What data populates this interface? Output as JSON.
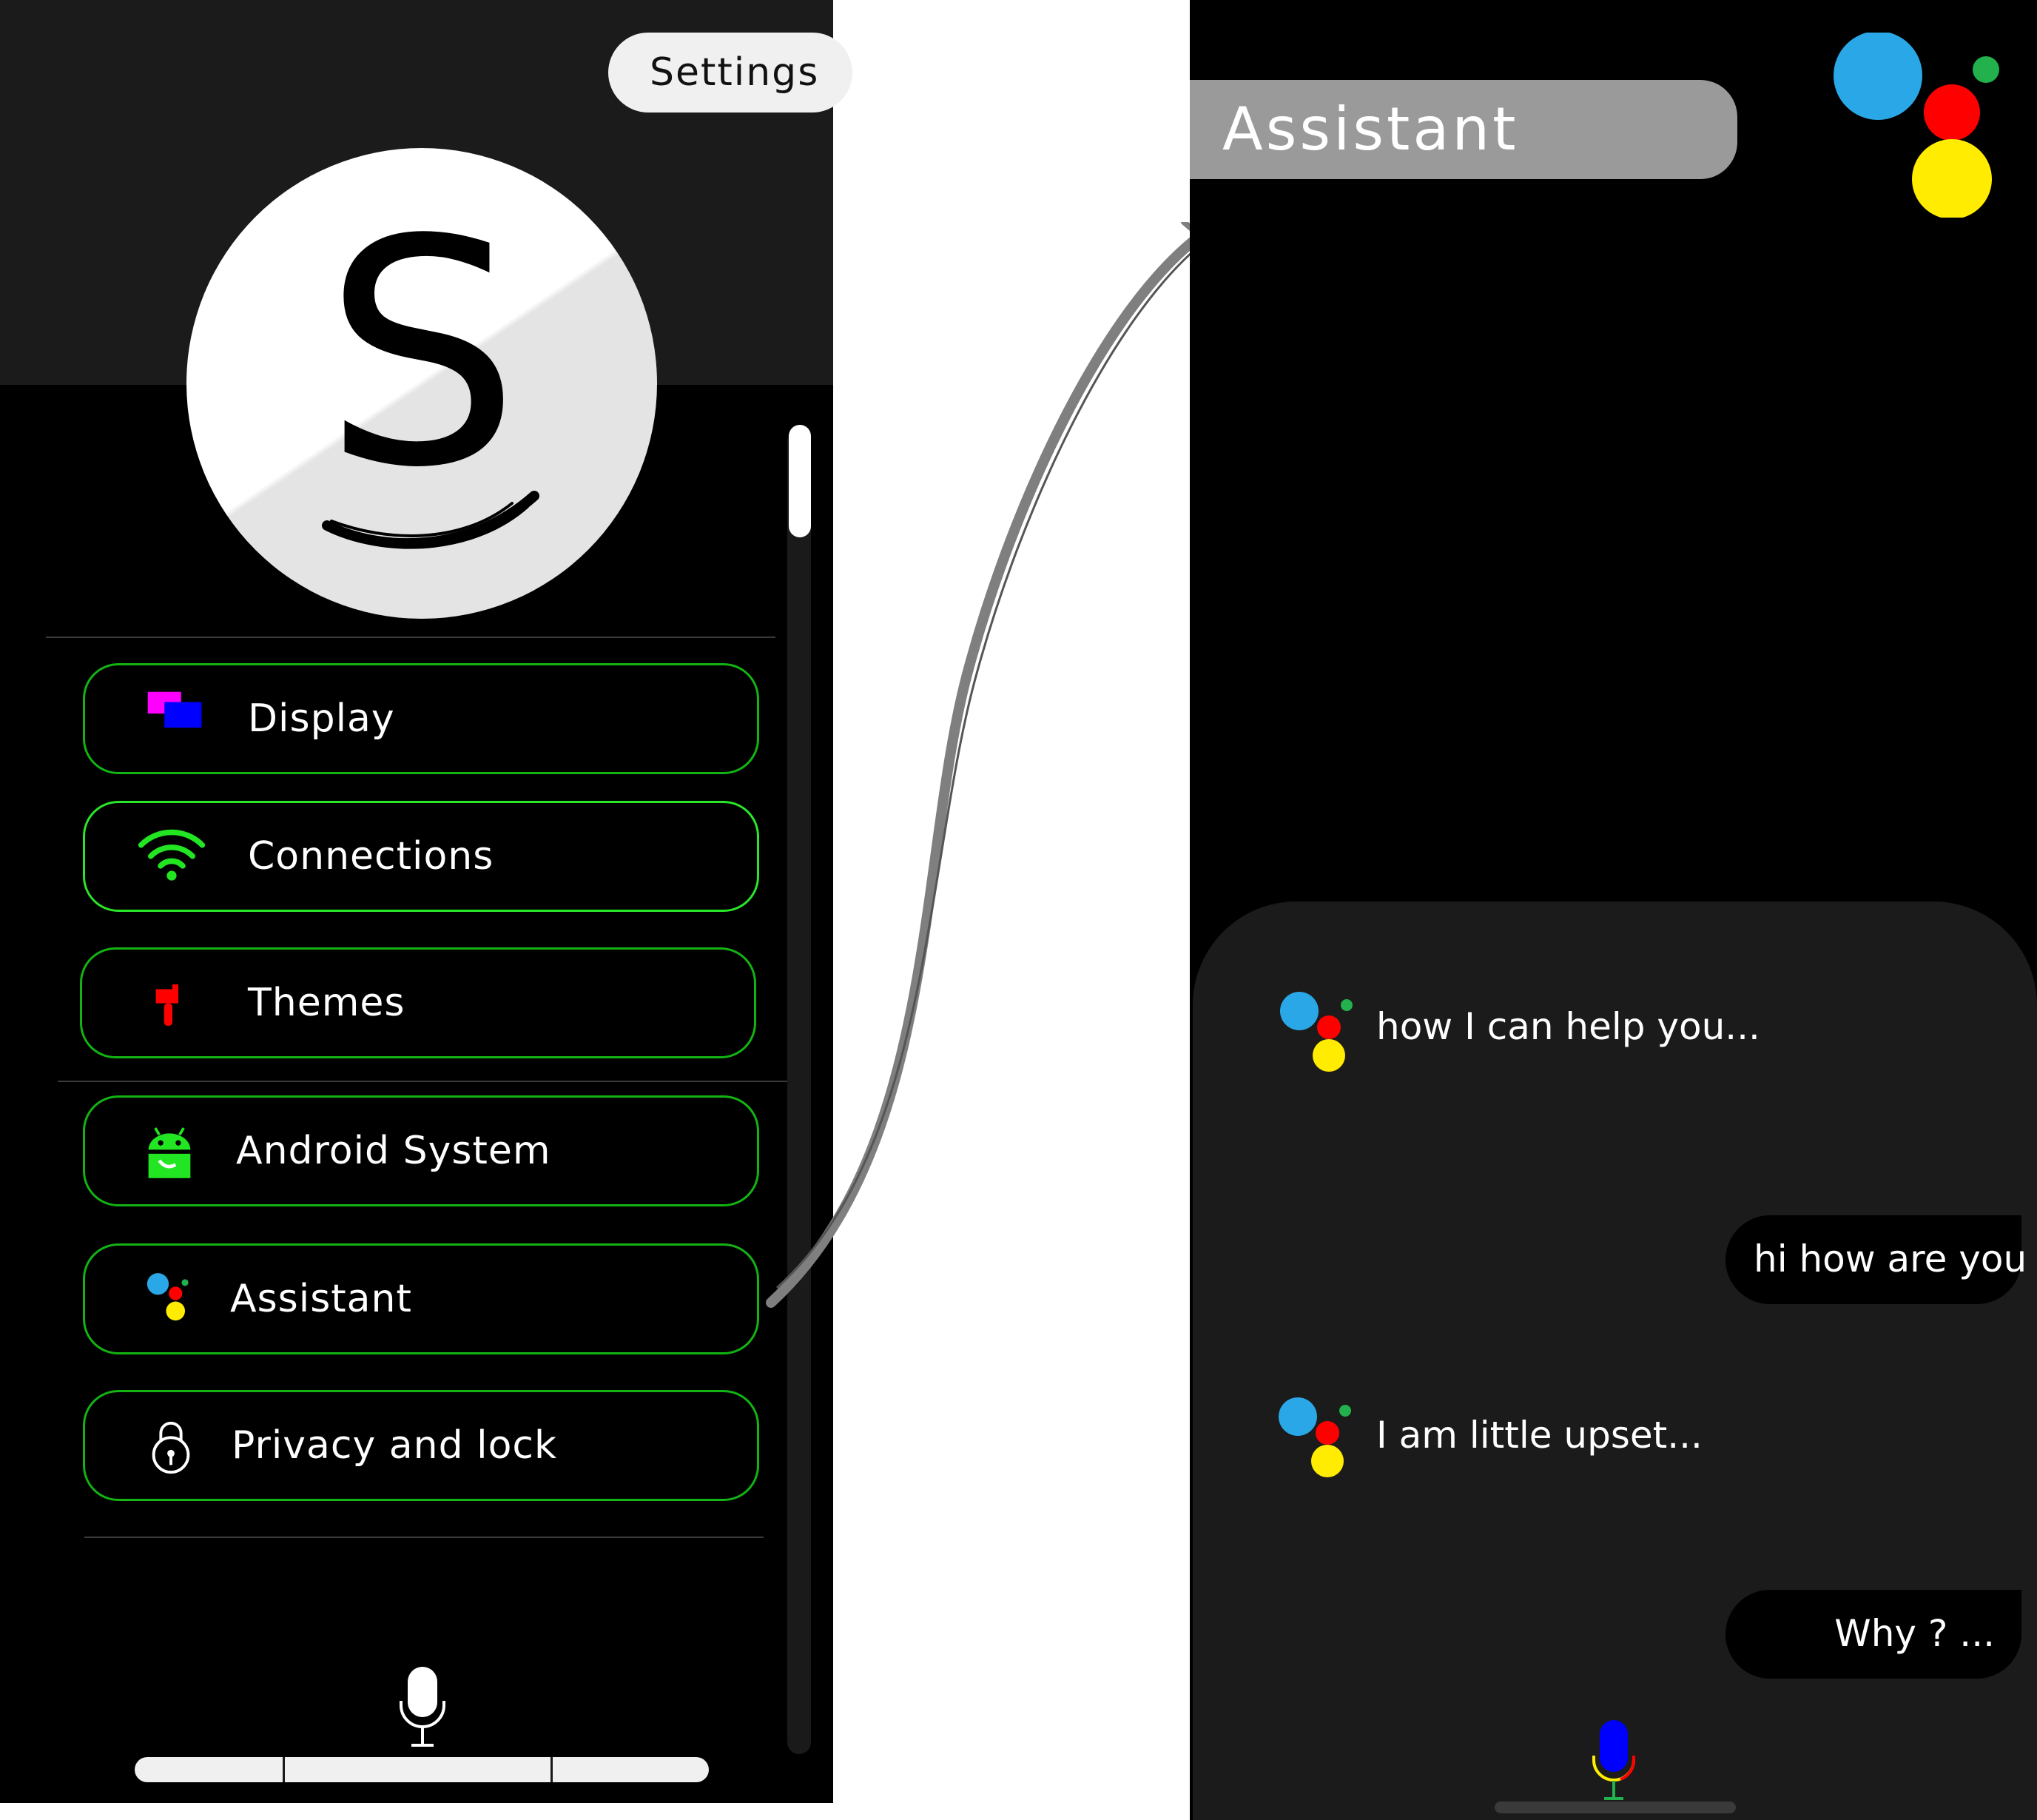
{
  "left_screen": {
    "settings_label": "Settings",
    "avatar_letter": "S",
    "menu": [
      {
        "label": "Display",
        "icon": "display-icon"
      },
      {
        "label": "Connections",
        "icon": "wifi-icon"
      },
      {
        "label": "Themes",
        "icon": "paint-roller-icon"
      },
      {
        "label": "Android System",
        "icon": "android-icon"
      },
      {
        "label": "Assistant",
        "icon": "assistant-dots-icon"
      },
      {
        "label": "Privacy and lock",
        "icon": "lock-icon"
      }
    ],
    "mic_icon": "microphone-icon"
  },
  "right_screen": {
    "title": "Assistant",
    "logo_icon": "assistant-logo-icon",
    "messages": [
      {
        "from": "assistant",
        "text": "how I can help you..."
      },
      {
        "from": "user",
        "text": "hi how are you"
      },
      {
        "from": "assistant",
        "text": "I am little upset..."
      },
      {
        "from": "user",
        "text": "Why ? ..."
      }
    ],
    "mic_icon": "microphone-icon"
  },
  "colors": {
    "menu_border": "#12b312",
    "menu_border_bright": "#28e628",
    "assistant_blue": "#2aa7e6",
    "assistant_red": "#ff0000",
    "assistant_yellow": "#ffec00",
    "assistant_green": "#22b14c"
  }
}
